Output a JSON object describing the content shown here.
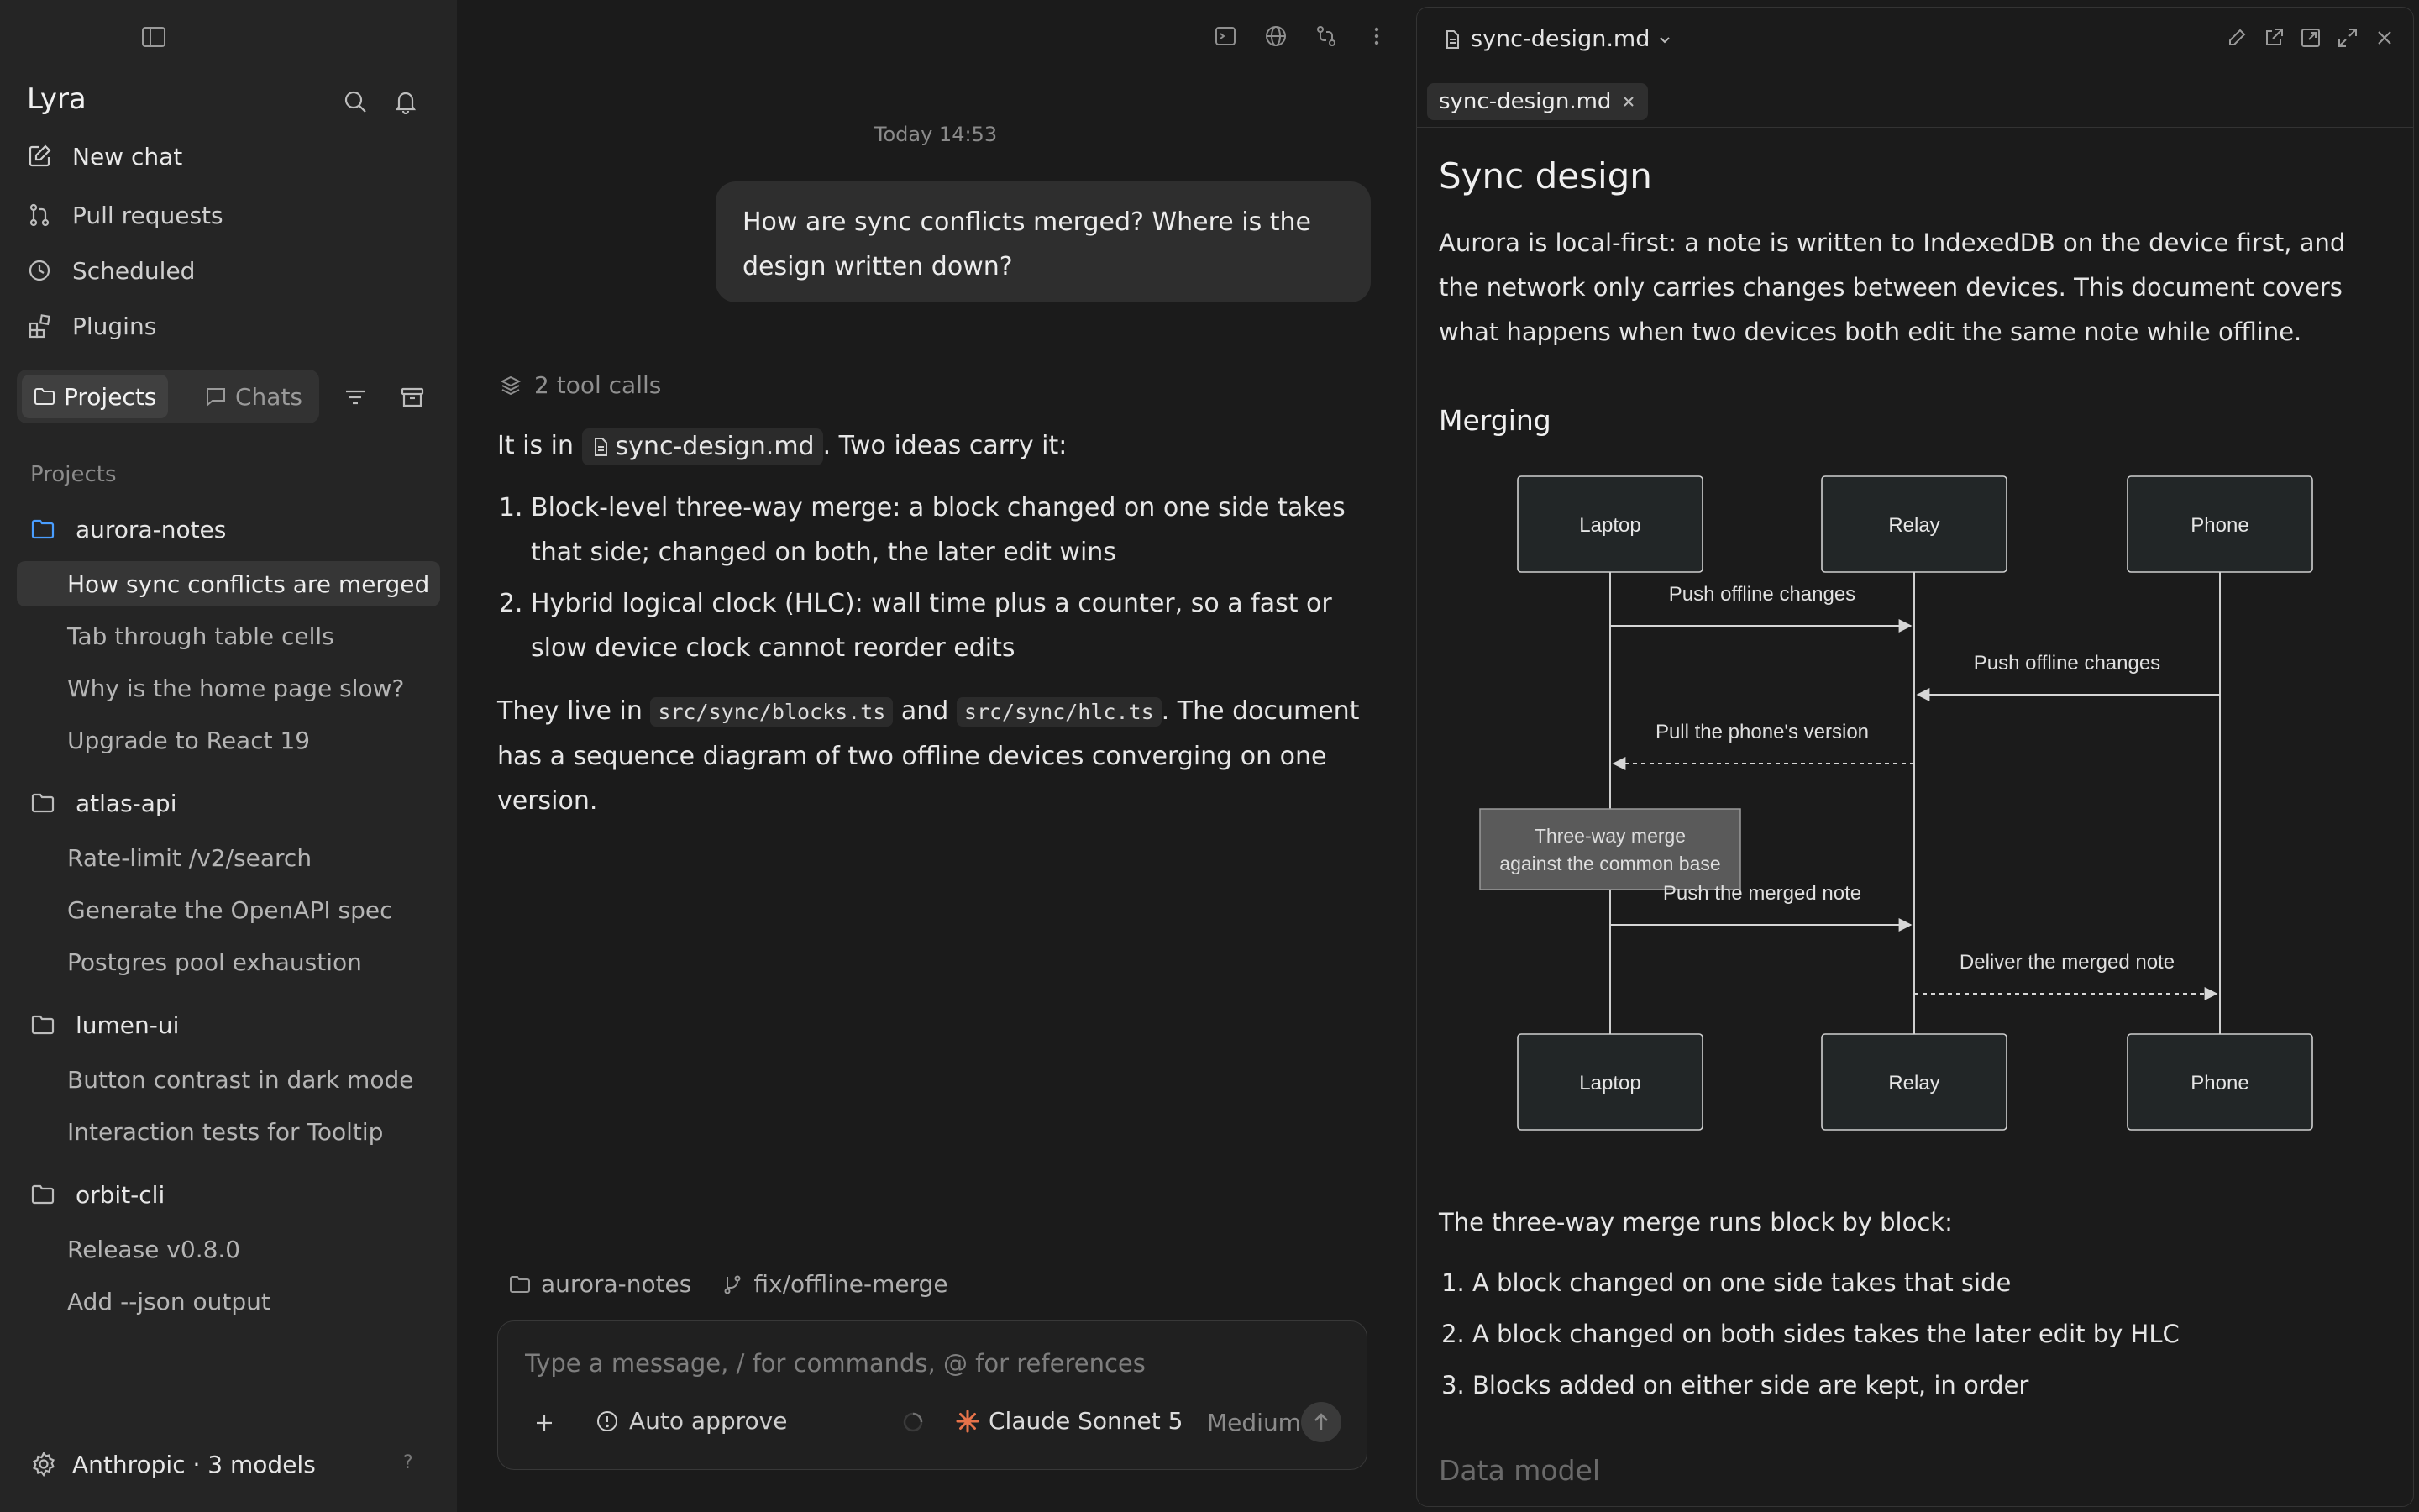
{
  "sidebar": {
    "app_name": "Lyra",
    "nav": [
      {
        "label": "New chat",
        "icon": "edit-icon"
      },
      {
        "label": "Pull requests",
        "icon": "pull-request-icon"
      },
      {
        "label": "Scheduled",
        "icon": "clock-icon"
      },
      {
        "label": "Plugins",
        "icon": "plugins-icon"
      }
    ],
    "tabs": {
      "projects": "Projects",
      "chats": "Chats",
      "active": "Projects"
    },
    "section_label": "Projects",
    "projects": [
      {
        "name": "aurora-notes",
        "active": true,
        "chats": [
          "How sync conflicts are merged",
          "Tab through table cells",
          "Why is the home page slow?",
          "Upgrade to React 19"
        ]
      },
      {
        "name": "atlas-api",
        "chats": [
          "Rate-limit /v2/search",
          "Generate the OpenAPI spec",
          "Postgres pool exhaustion"
        ]
      },
      {
        "name": "lumen-ui",
        "chats": [
          "Button contrast in dark mode",
          "Interaction tests for Tooltip"
        ]
      },
      {
        "name": "orbit-cli",
        "chats": [
          "Release v0.8.0",
          "Add --json output"
        ]
      }
    ],
    "active_chat": "How sync conflicts are merged",
    "footer": {
      "provider": "Anthropic · 3 models",
      "help": "?"
    }
  },
  "chat": {
    "timestamp": "Today 14:53",
    "user_message": "How are sync conflicts merged? Where is the design written down?",
    "tool_calls": "2 tool calls",
    "answer": {
      "intro_before": "It is in",
      "intro_file": "sync-design.md",
      "intro_after": ". Two ideas carry it:",
      "points": [
        "Block-level three-way merge: a block changed on one side takes that side; changed on both, the later edit wins",
        "Hybrid logical clock (HLC): wall time plus a counter, so a fast or slow device clock cannot reorder edits"
      ],
      "outro_1": "They live in",
      "code_1": "src/sync/blocks.ts",
      "outro_2": "and",
      "code_2": "src/sync/hlc.ts",
      "outro_3": ". The document has a sequence diagram of two offline devices converging on one version."
    },
    "context": {
      "project": "aurora-notes",
      "branch": "fix/offline-merge"
    },
    "composer": {
      "placeholder": "Type a message, / for commands, @ for references",
      "value": "",
      "auto_approve": "Auto approve",
      "model": "Claude Sonnet 5",
      "effort": "Medium"
    }
  },
  "doc": {
    "filename": "sync-design.md",
    "tab": "sync-design.md",
    "title": "Sync design",
    "intro": "Aurora is local-first: a note is written to IndexedDB on the device first, and the network only carries changes between devices. This document covers what happens when two devices both edit the same note while offline.",
    "h_merging": "Merging",
    "diagram": {
      "participants": [
        "Laptop",
        "Relay",
        "Phone"
      ],
      "messages": [
        {
          "from": 0,
          "to": 1,
          "label": "Push offline changes",
          "style": "solid"
        },
        {
          "from": 2,
          "to": 1,
          "label": "Push offline changes",
          "style": "solid"
        },
        {
          "from": 1,
          "to": 0,
          "label": "Pull the phone's version",
          "style": "dashed"
        },
        {
          "note": "Three-way merge\nagainst the common base",
          "over": 0
        },
        {
          "from": 0,
          "to": 1,
          "label": "Push the merged note",
          "style": "solid"
        },
        {
          "from": 1,
          "to": 2,
          "label": "Deliver the merged note",
          "style": "dashed"
        }
      ]
    },
    "merge_intro": "The three-way merge runs block by block:",
    "merge_rules": [
      "A block changed on one side takes that side",
      "A block changed on both sides takes the later edit by HLC",
      "Blocks added on either side are kept, in order"
    ],
    "h_data_model": "Data model"
  },
  "colors": {
    "accent_model": "#e8734a",
    "folder_active": "#4a9eff"
  }
}
